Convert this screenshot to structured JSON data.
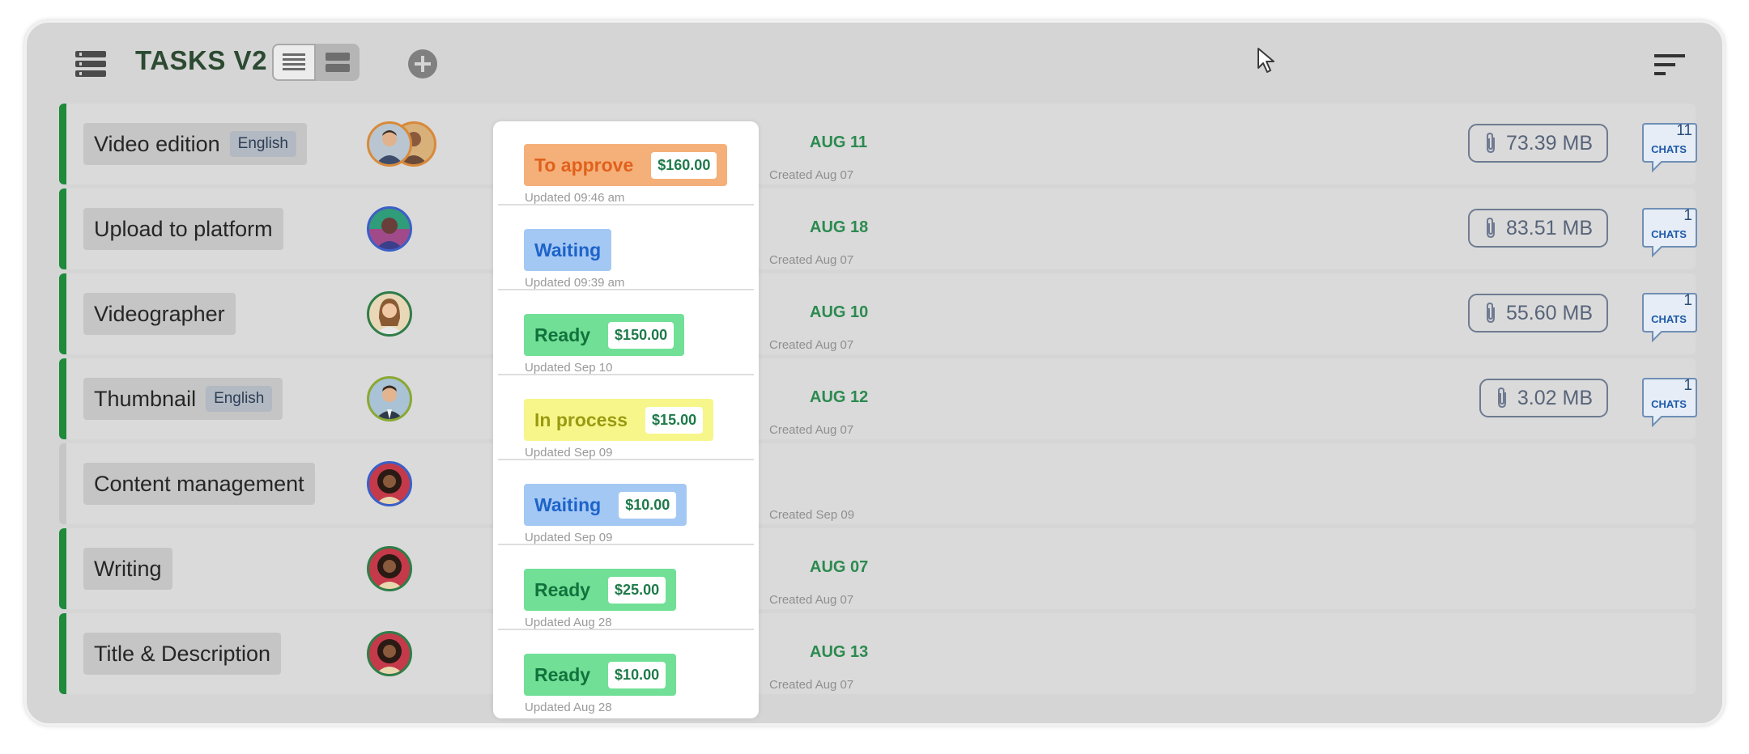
{
  "header": {
    "title": "TASKS V2",
    "menu_icon": "list-menu-icon",
    "view_toggle": [
      "list-view-icon",
      "compact-view-icon"
    ],
    "add_icon": "plus-circle-icon",
    "sort_icon": "sort-icon"
  },
  "colors": {
    "ready": "#71e096",
    "waiting": "#a4c8f4",
    "to_approve": "#f5b07a",
    "in_process": "#f7f68a",
    "accent_green": "#1e8a3a"
  },
  "tasks": [
    {
      "name": "Video edition",
      "language": "English",
      "status": "To approve",
      "price": "$160.00",
      "updated": "Updated 09:46 am",
      "due": "AUG 11",
      "created": "Created Aug 07",
      "size": "73.39 MB",
      "chats": "11",
      "chats_label": "CHATS"
    },
    {
      "name": "Upload to platform",
      "language": "",
      "status": "Waiting",
      "price": "",
      "updated": "Updated 09:39 am",
      "due": "AUG 18",
      "created": "Created Aug 07",
      "size": "83.51 MB",
      "chats": "1",
      "chats_label": "CHATS"
    },
    {
      "name": "Videographer",
      "language": "",
      "status": "Ready",
      "price": "$150.00",
      "updated": "Updated Sep 10",
      "due": "AUG 10",
      "created": "Created Aug 07",
      "size": "55.60 MB",
      "chats": "1",
      "chats_label": "CHATS"
    },
    {
      "name": "Thumbnail",
      "language": "English",
      "status": "In process",
      "price": "$15.00",
      "updated": "Updated Sep 09",
      "due": "AUG 12",
      "created": "Created Aug 07",
      "size": "3.02 MB",
      "chats": "1",
      "chats_label": "CHATS"
    },
    {
      "name": "Content management",
      "language": "",
      "status": "Waiting",
      "price": "$10.00",
      "updated": "Updated Sep 09",
      "due": "",
      "created": "Created Sep 09",
      "size": "",
      "chats": "",
      "chats_label": ""
    },
    {
      "name": "Writing",
      "language": "",
      "status": "Ready",
      "price": "$25.00",
      "updated": "Updated Aug 28",
      "due": "AUG 07",
      "created": "Created Aug 07",
      "size": "",
      "chats": "",
      "chats_label": ""
    },
    {
      "name": "Title & Description",
      "language": "",
      "status": "Ready",
      "price": "$10.00",
      "updated": "Updated Aug 28",
      "due": "AUG 13",
      "created": "Created Aug 07",
      "size": "",
      "chats": "",
      "chats_label": ""
    }
  ]
}
